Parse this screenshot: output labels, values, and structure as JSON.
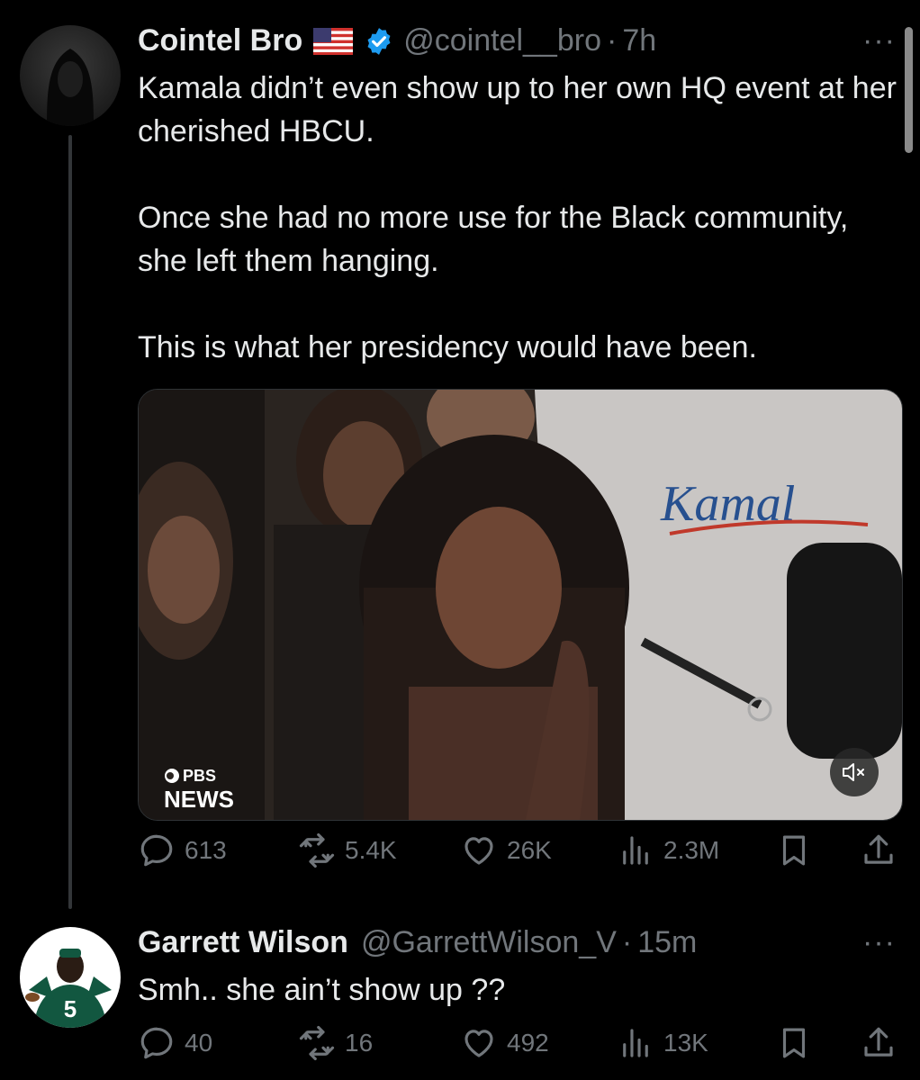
{
  "tweet1": {
    "name": "Cointel Bro",
    "flag_icon": "us-flag-icon",
    "verified_icon": "verified-badge-icon",
    "handle": "@cointel__bro",
    "separator": "·",
    "time": "7h",
    "more": "···",
    "paragraphs": [
      "Kamala didn’t even show up to her own HQ event at her cherished HBCU.",
      "Once she had no more use for the Black community, she left them hanging.",
      "This is what her presidency would have been."
    ],
    "media": {
      "shirt_text": "Kamal",
      "watermark_line1": "PBS",
      "watermark_line2": "NEWS",
      "mute_icon": "mute-speaker-icon"
    },
    "stats": {
      "replies": "613",
      "reposts": "5.4K",
      "likes": "26K",
      "views": "2.3M"
    }
  },
  "tweet2": {
    "name": "Garrett Wilson",
    "handle": "@GarrettWilson_V",
    "separator": "·",
    "time": "15m",
    "more": "···",
    "text": "Smh.. she ain’t show up ??",
    "jersey_number": "5",
    "stats": {
      "replies": "40",
      "reposts": "16",
      "likes": "492",
      "views": "13K"
    }
  },
  "colors": {
    "background": "#000000",
    "text": "#e7e9ea",
    "secondary": "#71767b",
    "verified": "#1d9bf0",
    "thread_line": "#333639"
  }
}
